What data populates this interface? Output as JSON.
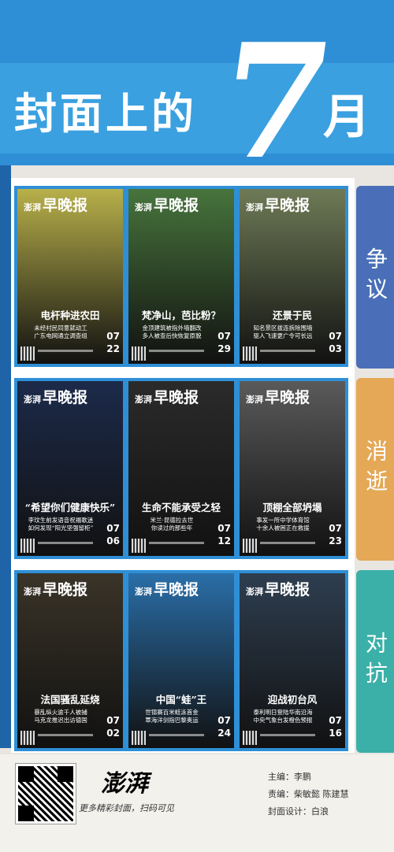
{
  "header": {
    "title_prefix": "封面上的",
    "seven": "7",
    "month": "月"
  },
  "rows": [
    {
      "tab": "争议",
      "tab_color": "#4a6fb8",
      "cards": [
        {
          "headline": "电杆种进农田",
          "sub": "未经村民同意就动工\n广东电网通立调查组",
          "mm": "07",
          "dd": "22",
          "bg": "#b8b04a"
        },
        {
          "headline": "梵净山，芭比粉？",
          "sub": "金顶建筑被指外墙翻改\n多人被查后快恢复原貌",
          "mm": "07",
          "dd": "29",
          "bg": "#47743c"
        },
        {
          "headline": "还景于民",
          "sub": "知名景区拔连拆除围墙\n驱人飞速更广令可长远",
          "mm": "07",
          "dd": "03",
          "bg": "#6e7a56"
        }
      ]
    },
    {
      "tab": "消逝",
      "tab_color": "#e4a856",
      "cards": [
        {
          "headline": "“希望你们健康快乐”",
          "sub": "李玟生前发语音祝福歌迷\n如何发现“阳光坚强留柜”",
          "mm": "07",
          "dd": "06",
          "bg": "#1c2a4a"
        },
        {
          "headline": "生命不能承受之轻",
          "sub": "米兰·昆德拉去世\n你读过的那些年",
          "mm": "07",
          "dd": "12",
          "bg": "#2b2b2b"
        },
        {
          "headline": "顶棚全部坍塌",
          "sub": "事发一所中学体育馆\n十余人被困正在救援",
          "mm": "07",
          "dd": "23",
          "bg": "#5a5a5a"
        }
      ]
    },
    {
      "tab": "对抗",
      "tab_color": "#3bb0a8",
      "cards": [
        {
          "headline": "法国骚乱延烧",
          "sub": "暴乱纵火逾千人被捕\n马克龙推迟出访德国",
          "mm": "07",
          "dd": "02",
          "bg": "#3a3428"
        },
        {
          "headline": "中国“蛙”王",
          "sub": "世锦赛百米蛙泳首金\n覃海洋剑指巴黎奥运",
          "mm": "07",
          "dd": "24",
          "bg": "#2a6ea8"
        },
        {
          "headline": "迎战初台风",
          "sub": "泰利明日登陆华南沿海\n中央气象台发橙色预报",
          "mm": "07",
          "dd": "16",
          "bg": "#2e3e50"
        }
      ]
    }
  ],
  "card_logo": {
    "small": "澎湃",
    "big": "早晚报"
  },
  "footer": {
    "brand": "澎湃",
    "slogan": "更多精彩封面，扫码可见",
    "chief": "主编：李鹏",
    "editors": "责编：柴敏懿 陈建慧",
    "design": "封面设计：白浪"
  }
}
